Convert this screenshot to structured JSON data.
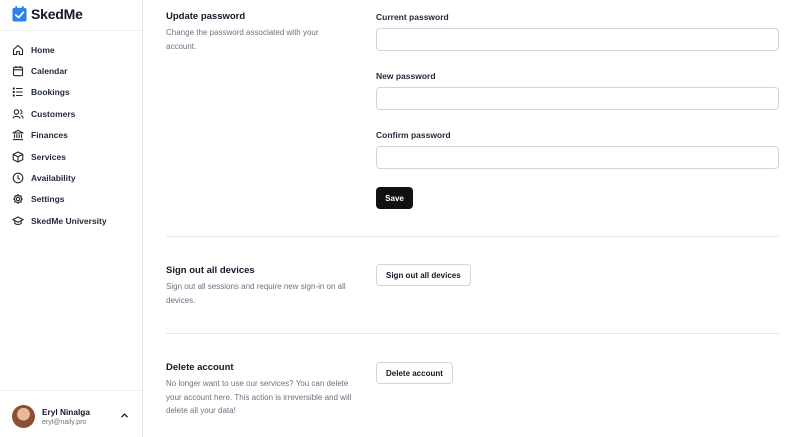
{
  "app": {
    "name": "SkedMe"
  },
  "sidebar": {
    "items": [
      {
        "label": "Home",
        "icon": "home-icon"
      },
      {
        "label": "Calendar",
        "icon": "calendar-icon"
      },
      {
        "label": "Bookings",
        "icon": "list-icon"
      },
      {
        "label": "Customers",
        "icon": "users-icon"
      },
      {
        "label": "Finances",
        "icon": "bank-icon"
      },
      {
        "label": "Services",
        "icon": "box-icon"
      },
      {
        "label": "Availability",
        "icon": "clock-icon"
      },
      {
        "label": "Settings",
        "icon": "gear-icon"
      },
      {
        "label": "SkedMe University",
        "icon": "graduation-cap-icon"
      }
    ]
  },
  "user": {
    "name": "Eryl Ninalga",
    "email": "eryl@naily.pro"
  },
  "update_password": {
    "title": "Update password",
    "description": "Change the password associated with your account.",
    "current_label": "Current password",
    "current_value": "",
    "new_label": "New password",
    "new_value": "",
    "confirm_label": "Confirm password",
    "confirm_value": "",
    "save_label": "Save"
  },
  "sign_out": {
    "title": "Sign out all devices",
    "description": "Sign out all sessions and require new sign-in on all devices.",
    "button_label": "Sign out all devices"
  },
  "delete_account": {
    "title": "Delete account",
    "description": "No longer want to use our services? You can delete your account here. This action is irreversible and will delete all your data!",
    "button_label": "Delete account"
  },
  "colors": {
    "accent": "#3b82f6",
    "primary_button": "#111111",
    "border": "#d1d5db",
    "muted_text": "#6b7280"
  }
}
